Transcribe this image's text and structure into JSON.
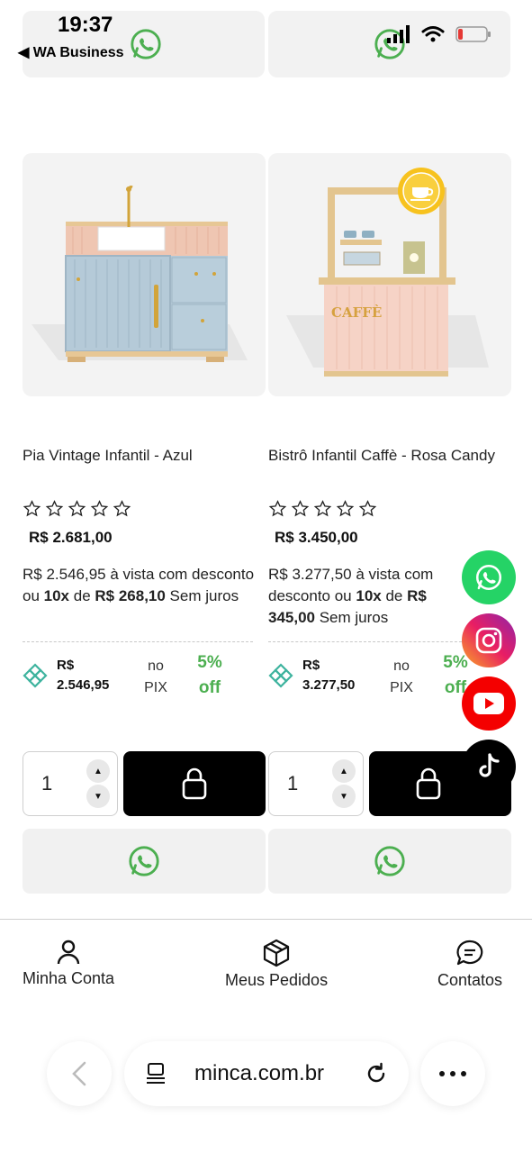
{
  "status_bar": {
    "time": "19:37",
    "back_app": "◀ WA Business"
  },
  "products": [
    {
      "name": "Pia Vintage Infantil - Azul",
      "price": "R$ 2.681,00",
      "installment_part1": "R$ 2.546,95 à vista com desconto ou ",
      "installment_count": "10x",
      "installment_de": " de ",
      "installment_value": "R$ 268,10",
      "installment_suffix": " Sem juros",
      "pix_amount_line1": "R$",
      "pix_amount_line2": "2.546,95",
      "pix_no": "no",
      "pix_label": "PIX",
      "pix_discount": "5%",
      "pix_off": "off",
      "quantity": "1"
    },
    {
      "name": "Bistrô Infantil Caffè - Rosa Candy",
      "price": "R$ 3.450,00",
      "installment_part1": "R$ 3.277,50 à vista com desconto ou ",
      "installment_count": "10x",
      "installment_de": " de ",
      "installment_value": "R$ 345,00",
      "installment_suffix": " Sem juros",
      "pix_amount_line1": "R$",
      "pix_amount_line2": "3.277,50",
      "pix_no": "no",
      "pix_label": "PIX",
      "pix_discount": "5%",
      "pix_off": "off",
      "quantity": "1",
      "image_sign": "CAFFÈ"
    }
  ],
  "bottom_nav": {
    "account": "Minha Conta",
    "orders": "Meus Pedidos",
    "contacts": "Contatos"
  },
  "browser": {
    "url": "minca.com.br"
  },
  "colors": {
    "whatsapp_green": "#4caf50",
    "youtube_red": "#f40000",
    "discount_green": "#4caf50"
  },
  "icons": [
    "whatsapp-icon",
    "instagram-icon",
    "youtube-icon",
    "tiktok-icon",
    "lock-icon",
    "user-icon",
    "package-icon",
    "chat-icon",
    "reload-icon",
    "more-icon",
    "back-icon",
    "tabs-icon",
    "star-icon",
    "pix-icon"
  ]
}
